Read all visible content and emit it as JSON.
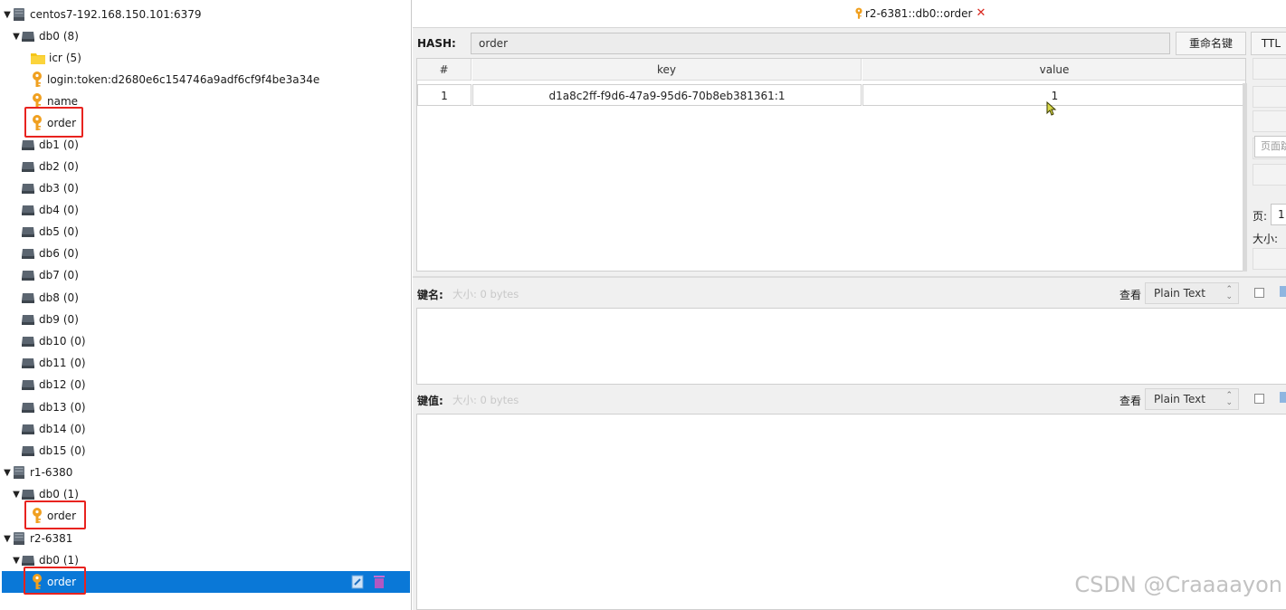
{
  "tree": {
    "connections": [
      {
        "name": "centos7-192.168.150.101:6379",
        "databases": [
          {
            "name": "db0",
            "count": "(8)",
            "children": [
              {
                "type": "folder",
                "label": "icr",
                "count": "(5)"
              },
              {
                "type": "key",
                "label": "login:token:d2680e6c154746a9adf6cf9f4be3a34e"
              },
              {
                "type": "key",
                "label": "name"
              },
              {
                "type": "key",
                "label": "order"
              }
            ]
          },
          {
            "name": "db1",
            "count": "(0)"
          },
          {
            "name": "db2",
            "count": "(0)"
          },
          {
            "name": "db3",
            "count": "(0)"
          },
          {
            "name": "db4",
            "count": "(0)"
          },
          {
            "name": "db5",
            "count": "(0)"
          },
          {
            "name": "db6",
            "count": "(0)"
          },
          {
            "name": "db7",
            "count": "(0)"
          },
          {
            "name": "db8",
            "count": "(0)"
          },
          {
            "name": "db9",
            "count": "(0)"
          },
          {
            "name": "db10",
            "count": "(0)"
          },
          {
            "name": "db11",
            "count": "(0)"
          },
          {
            "name": "db12",
            "count": "(0)"
          },
          {
            "name": "db13",
            "count": "(0)"
          },
          {
            "name": "db14",
            "count": "(0)"
          },
          {
            "name": "db15",
            "count": "(0)"
          }
        ]
      },
      {
        "name": "r1-6380",
        "databases": [
          {
            "name": "db0",
            "count": "(1)",
            "children": [
              {
                "type": "key",
                "label": "order"
              }
            ]
          }
        ]
      },
      {
        "name": "r2-6381",
        "databases": [
          {
            "name": "db0",
            "count": "(1)",
            "children": [
              {
                "type": "key",
                "label": "order",
                "selected": true
              }
            ]
          }
        ]
      }
    ]
  },
  "tab": {
    "title": "r2-6381::db0::order",
    "close": "✕"
  },
  "hash": {
    "label": "HASH:",
    "key_name": "order",
    "rename_button": "重命名键",
    "ttl_button": "TTL"
  },
  "table": {
    "columns": [
      "#",
      "key",
      "value"
    ],
    "rows": [
      {
        "index": "1",
        "key": "d1a8c2ff-f9d6-47a9-95d6-70b8eb381361:1",
        "value": "1"
      }
    ]
  },
  "side": {
    "page_jump_placeholder": "页面跳转",
    "page_label": "页:",
    "page_value": "1",
    "size_label": "大小:"
  },
  "key_field": {
    "label": "键名:",
    "size": "大小: 0 bytes",
    "view_label": "查看",
    "view_mode": "Plain Text"
  },
  "value_field": {
    "label": "键值:",
    "size": "大小: 0 bytes",
    "view_label": "查看",
    "view_mode": "Plain Text"
  },
  "watermark": "CSDN @Craaaayon",
  "colors": {
    "selection": "#0a78d7",
    "highlight_box": "#e8231f",
    "key_icon": "#f0a020",
    "folder_icon": "#f5c518"
  }
}
